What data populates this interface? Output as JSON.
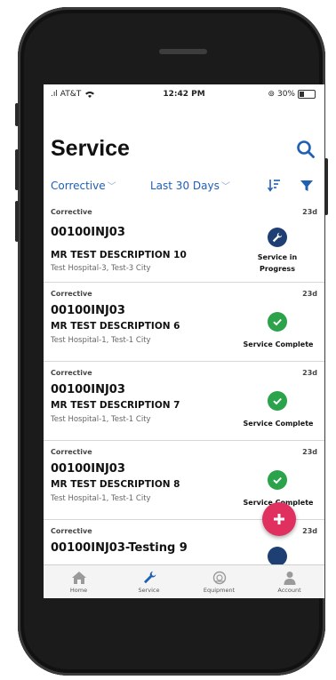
{
  "status_bar": {
    "carrier": "AT&T",
    "time": "12:42 PM",
    "battery": "30%"
  },
  "header": {
    "title": "Service",
    "search_icon": "search-icon"
  },
  "filters": {
    "type": "Corrective",
    "range": "Last 30 Days",
    "sort_icon": "sort-icon",
    "filter_icon": "filter-icon"
  },
  "items": [
    {
      "type": "Corrective",
      "age": "23d",
      "code": "00100INJ03",
      "description": "MR  TEST DESCRIPTION 10",
      "location": "Test Hospital-3, Test-3 City",
      "status": "Service in Progress",
      "status_line1": "Service in",
      "status_line2": "Progress",
      "status_icon": "wrench-icon"
    },
    {
      "type": "Corrective",
      "age": "23d",
      "code": "00100INJ03",
      "description": "MR  TEST DESCRIPTION 6",
      "location": "Test Hospital-1, Test-1 City",
      "status": "Service Complete",
      "status_icon": "check-icon"
    },
    {
      "type": "Corrective",
      "age": "23d",
      "code": "00100INJ03",
      "description": "MR  TEST DESCRIPTION 7",
      "location": "Test Hospital-1, Test-1 City",
      "status": "Service Complete",
      "status_icon": "check-icon"
    },
    {
      "type": "Corrective",
      "age": "23d",
      "code": "00100INJ03",
      "description": "MR  TEST DESCRIPTION 8",
      "location": "Test Hospital-1, Test-1 City",
      "status": "Service Complete",
      "status_icon": "check-icon"
    },
    {
      "type": "Corrective",
      "age": "23d",
      "code": "00100INJ03-Testing  9"
    }
  ],
  "tabs": [
    {
      "label": "Home",
      "icon": "home-icon"
    },
    {
      "label": "Service",
      "icon": "wrench-icon",
      "active": true
    },
    {
      "label": "Equipment",
      "icon": "equipment-icon"
    },
    {
      "label": "Account",
      "icon": "account-icon"
    }
  ],
  "colors": {
    "accent": "#1f5fb4",
    "navy": "#1e3f73",
    "success": "#2ba34b",
    "fab": "#e03060"
  }
}
